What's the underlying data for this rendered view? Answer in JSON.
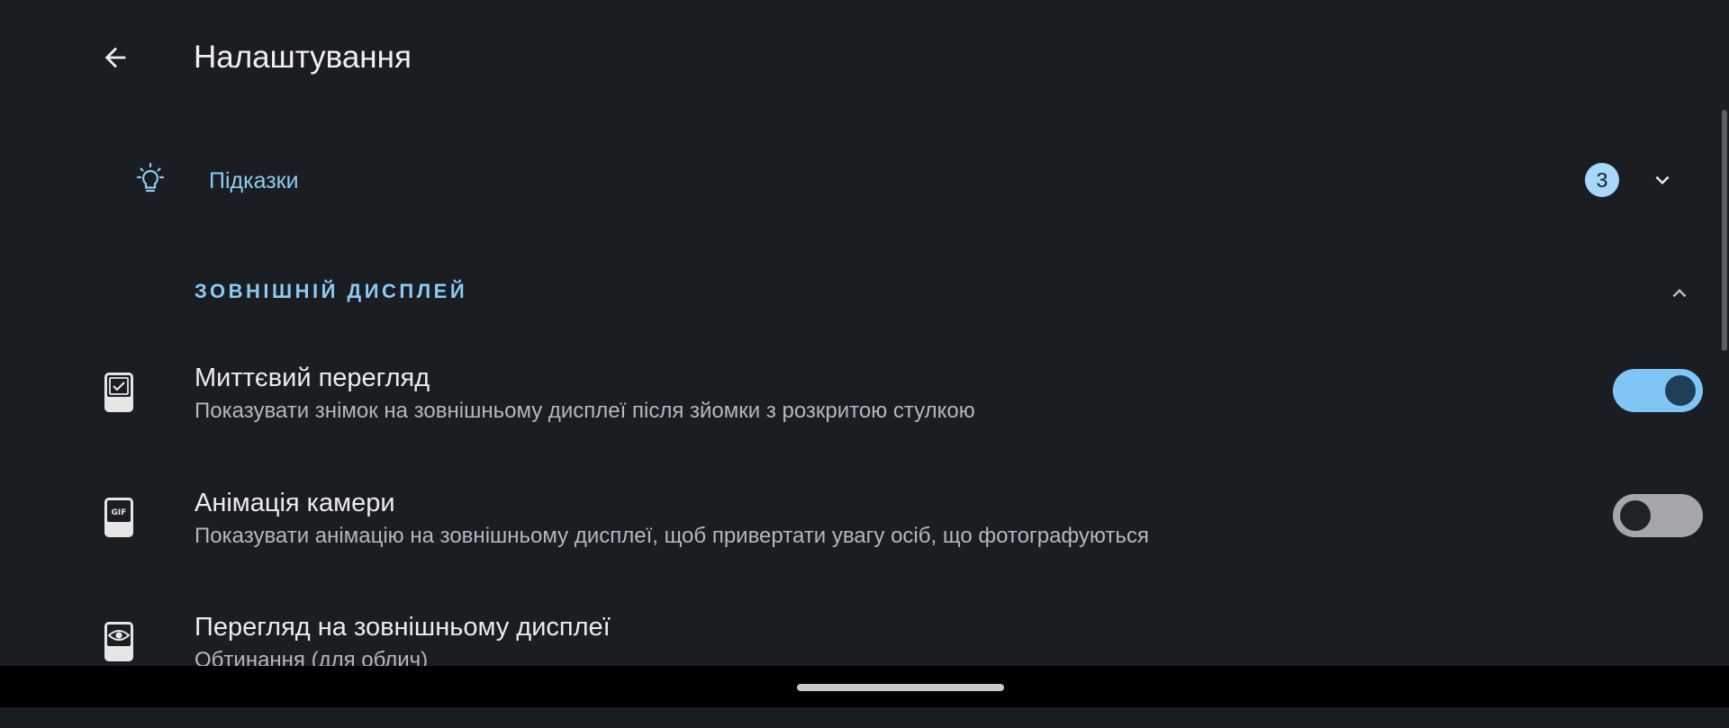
{
  "header": {
    "title": "Налаштування",
    "back_icon": "arrow-back-icon"
  },
  "hints": {
    "label": "Підказки",
    "badge_count": "3",
    "icon": "lightbulb-icon",
    "expand_icon": "chevron-down-icon"
  },
  "section": {
    "title": "ЗОВНІШНІЙ ДИСПЛЕЙ",
    "collapse_icon": "chevron-up-icon"
  },
  "settings": [
    {
      "title": "Миттєвий перегляд",
      "summary": "Показувати знімок на зовнішньому дисплеї після зйомки з розкритою стулкою",
      "icon": "quick-view-icon",
      "enabled": true
    },
    {
      "title": "Анімація камери",
      "summary": "Показувати анімацію на зовнішньому дисплеї, щоб привертати увагу осіб, що фотографуються",
      "icon": "gif-icon",
      "enabled": false
    },
    {
      "title": "Перегляд на зовнішньому дисплеї",
      "summary": "Обтинання (для облич)",
      "icon": "eye-icon"
    }
  ],
  "colors": {
    "background": "#1a1d21",
    "accent": "#8ecaf2",
    "switch_on": "#7fc6f6",
    "switch_off": "#a4a6aa"
  }
}
